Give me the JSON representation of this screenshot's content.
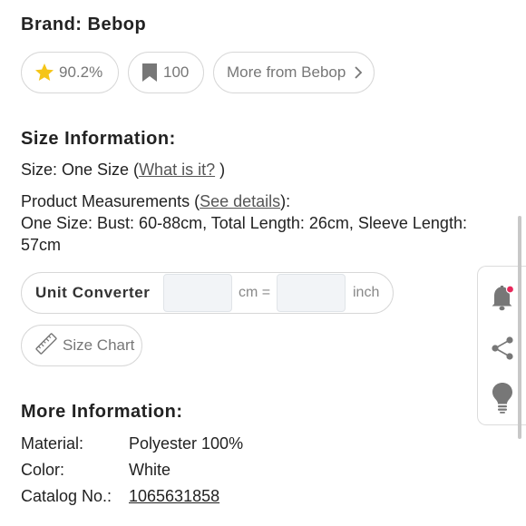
{
  "brand": {
    "label": "Brand: Bebop"
  },
  "badges": {
    "rating": "90.2%",
    "saved": "100",
    "more_from": "More from Bebop"
  },
  "size_info": {
    "title": "Size Information:",
    "size_prefix": "Size: One Size (",
    "what_is_it": "What is it?",
    "size_suffix": " )",
    "measurements_prefix": "Product Measurements (",
    "see_details": "See details",
    "measurements_suffix": "):",
    "measurements_line1": "One Size: Bust: 60-88cm, Total Length: 26cm, Sleeve Length:",
    "measurements_line2": "57cm"
  },
  "converter": {
    "label": "Unit Converter",
    "unit_from": "cm =",
    "unit_to": "inch",
    "cm_value": "",
    "inch_value": ""
  },
  "size_chart": {
    "label": "Size Chart"
  },
  "more_info": {
    "title": "More Information:",
    "rows": [
      {
        "label": "Material:",
        "value": "Polyester 100%"
      },
      {
        "label": "Color:",
        "value": "White"
      },
      {
        "label": "Catalog No.:",
        "value": "1065631858"
      }
    ]
  },
  "side_actions": {
    "icons": [
      "bell-icon",
      "share-icon",
      "lightbulb-icon"
    ],
    "notification_dot_color": "#e8275a"
  },
  "colors": {
    "star": "#f5c518",
    "muted_text": "#777777",
    "border": "#d7d7d7"
  }
}
